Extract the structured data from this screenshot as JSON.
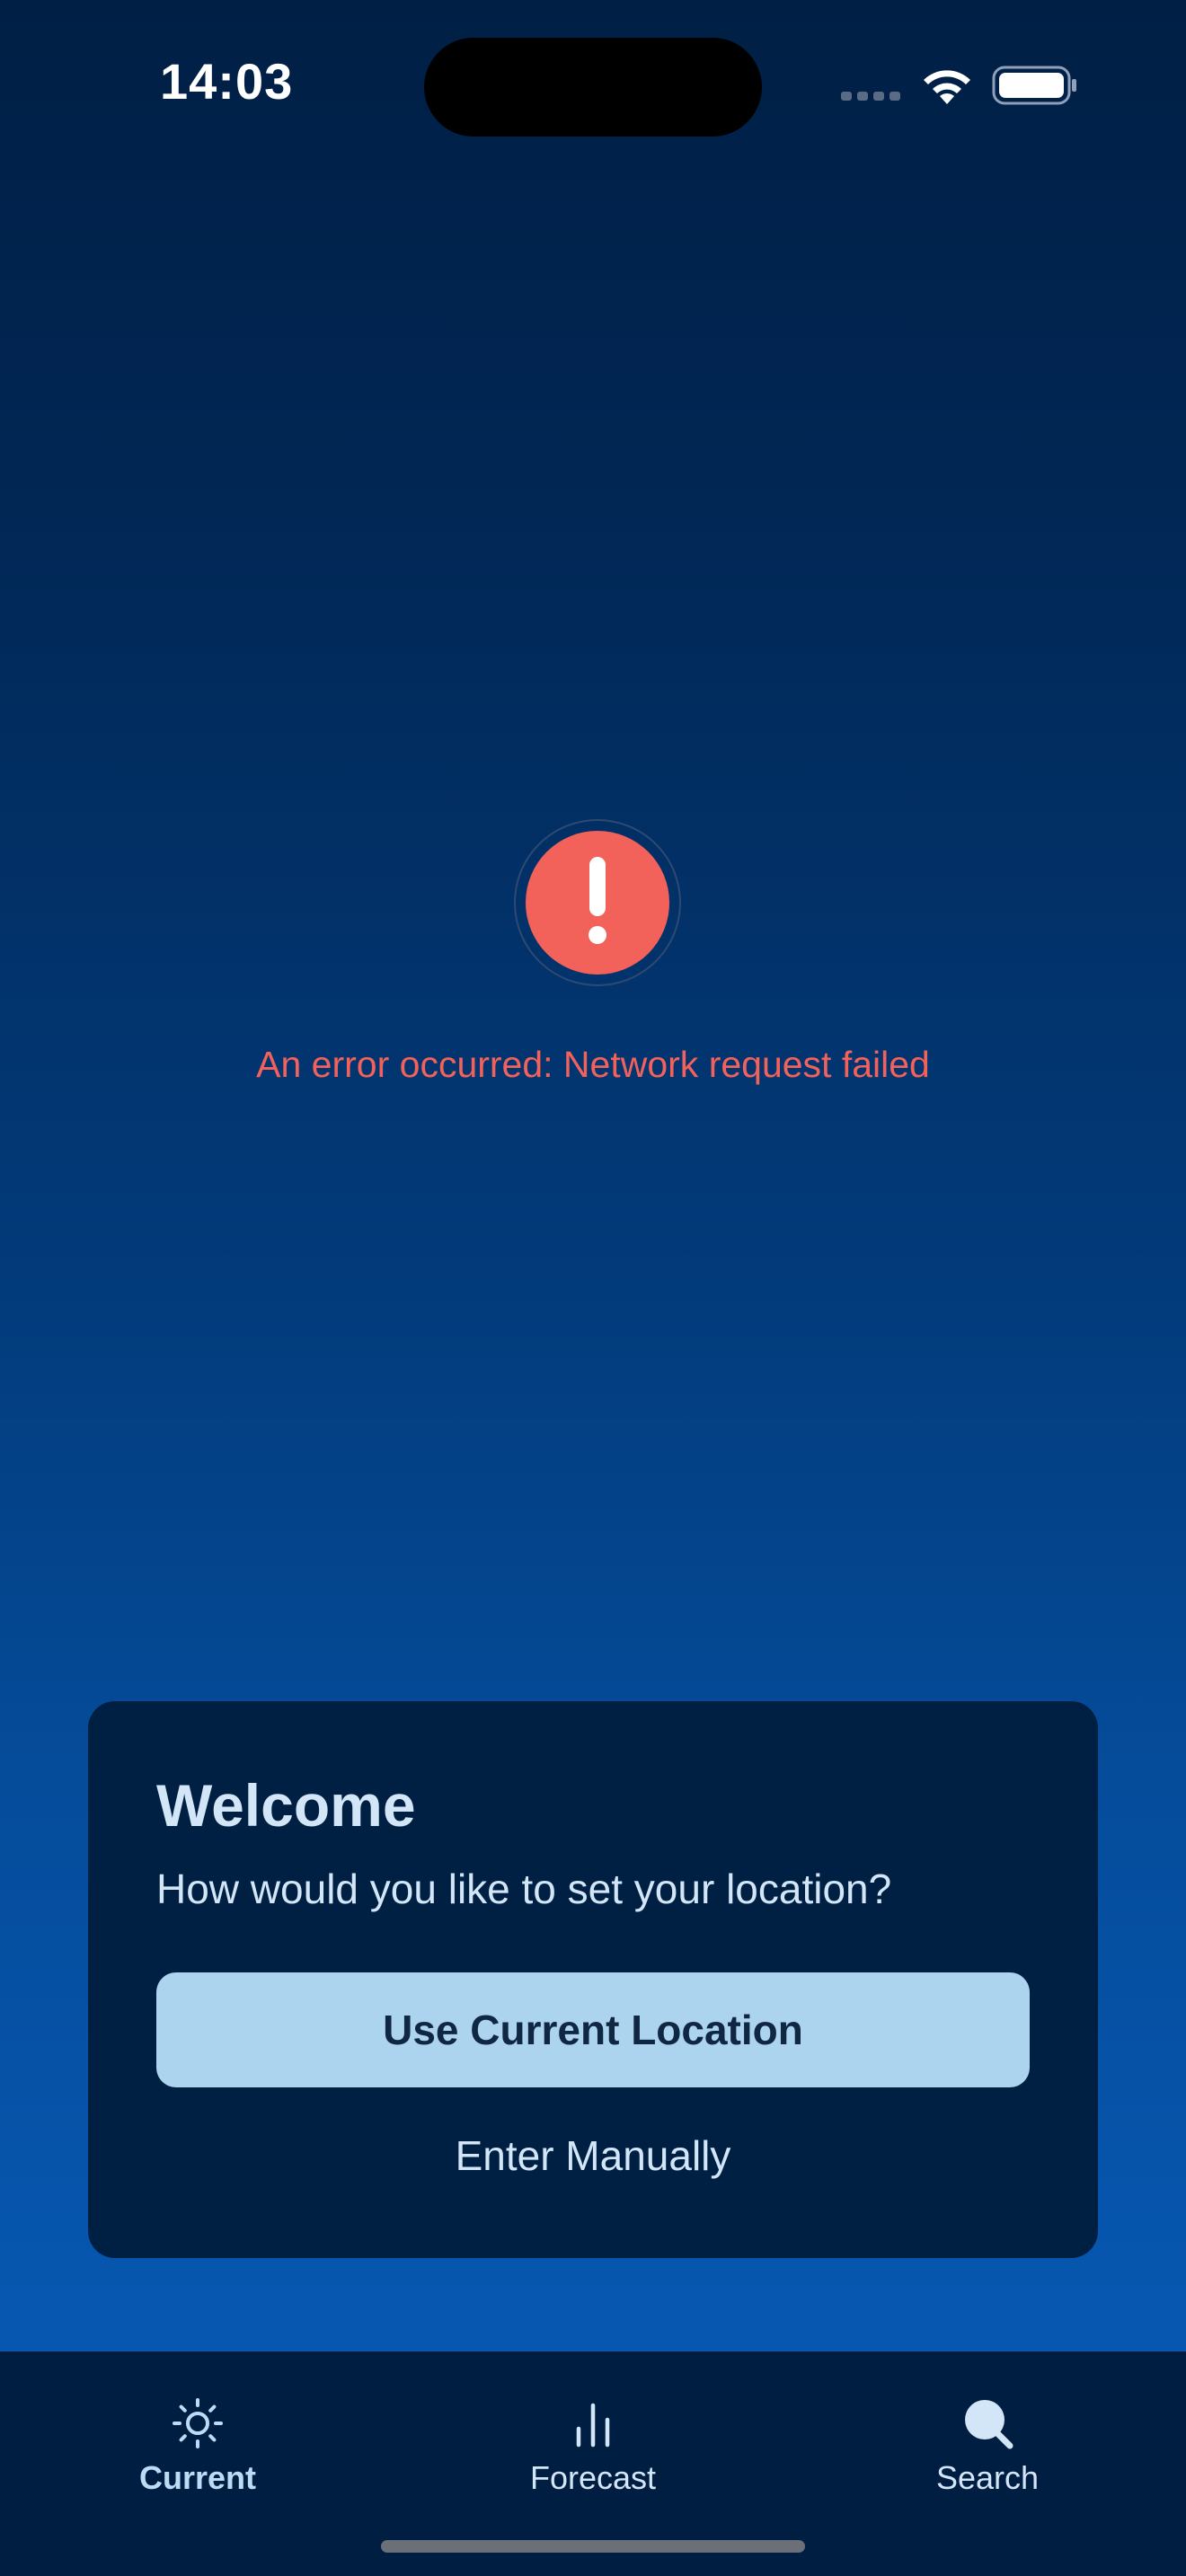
{
  "status_bar": {
    "time": "14:03",
    "icons": [
      "cellular-signal-icon",
      "wifi-icon",
      "battery-icon"
    ]
  },
  "error": {
    "icon": "exclamation-circle-icon",
    "message": "An error occurred: Network request failed",
    "color": "#f2615a"
  },
  "welcome_card": {
    "title": "Welcome",
    "subtitle": "How would you like to set your location?",
    "primary_button_label": "Use Current Location",
    "secondary_button_label": "Enter Manually"
  },
  "tab_bar": {
    "tabs": [
      {
        "label": "Current",
        "icon": "sun-icon",
        "active": true
      },
      {
        "label": "Forecast",
        "icon": "bar-chart-icon",
        "active": false
      },
      {
        "label": "Search",
        "icon": "search-icon",
        "active": false
      }
    ]
  },
  "colors": {
    "background_top": "#001f45",
    "background_bottom": "#0759b4",
    "card": "#002043",
    "primary_button": "#acd4ef",
    "tab_bar": "#001e42"
  }
}
